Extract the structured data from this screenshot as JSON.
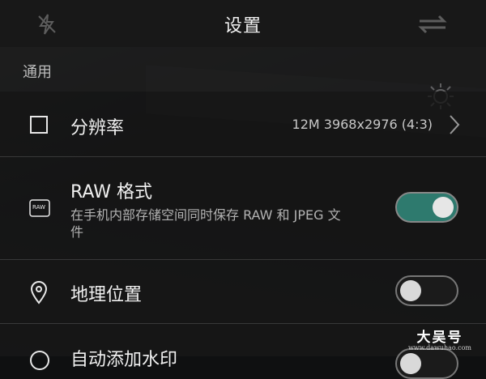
{
  "header": {
    "title": "设置",
    "left_icon": "flash-off-icon",
    "right_icon": "switch-camera-icon"
  },
  "section": {
    "label": "通用"
  },
  "settings": [
    {
      "id": "resolution",
      "icon": "square-icon",
      "title": "分辨率",
      "value": "12M 3968x2976 (4:3)",
      "control": "chevron"
    },
    {
      "id": "raw-format",
      "icon": "raw-icon",
      "icon_text": "RAW",
      "title": "RAW 格式",
      "subtitle_line1": "在手机内部存储空间同时保存 RAW 和 JPEG 文",
      "subtitle_line2": "件",
      "control": "toggle",
      "enabled": true
    },
    {
      "id": "location",
      "icon": "location-pin-icon",
      "title": "地理位置",
      "control": "toggle",
      "enabled": false
    },
    {
      "id": "watermark",
      "icon": "circle-icon",
      "title": "自动添加水印",
      "control": "toggle",
      "enabled": false
    }
  ],
  "watermark": {
    "main": "大吴号",
    "sub": "www.dawuhao.com"
  },
  "colors": {
    "toggle_on": "#2e7a6e",
    "background": "#121314"
  }
}
